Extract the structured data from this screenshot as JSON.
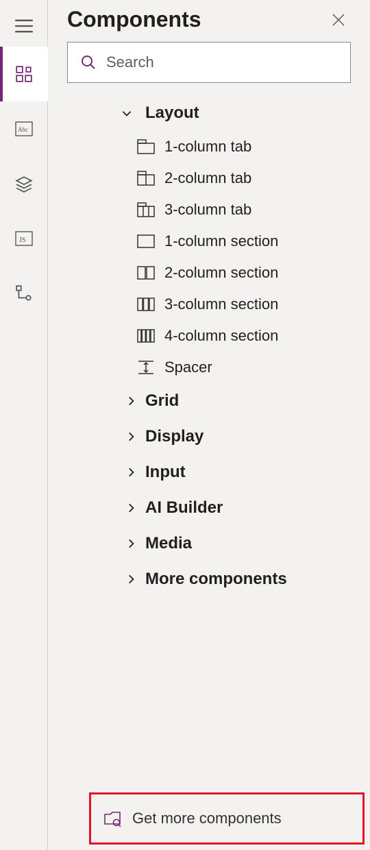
{
  "panel": {
    "title": "Components",
    "search_placeholder": "Search"
  },
  "groups": {
    "layout": {
      "label": "Layout",
      "items": [
        "1-column tab",
        "2-column tab",
        "3-column tab",
        "1-column section",
        "2-column section",
        "3-column section",
        "4-column section",
        "Spacer"
      ]
    },
    "grid": {
      "label": "Grid"
    },
    "display": {
      "label": "Display"
    },
    "input": {
      "label": "Input"
    },
    "aibuilder": {
      "label": "AI Builder"
    },
    "media": {
      "label": "Media"
    },
    "more": {
      "label": "More components"
    }
  },
  "footer": {
    "label": "Get more components"
  }
}
